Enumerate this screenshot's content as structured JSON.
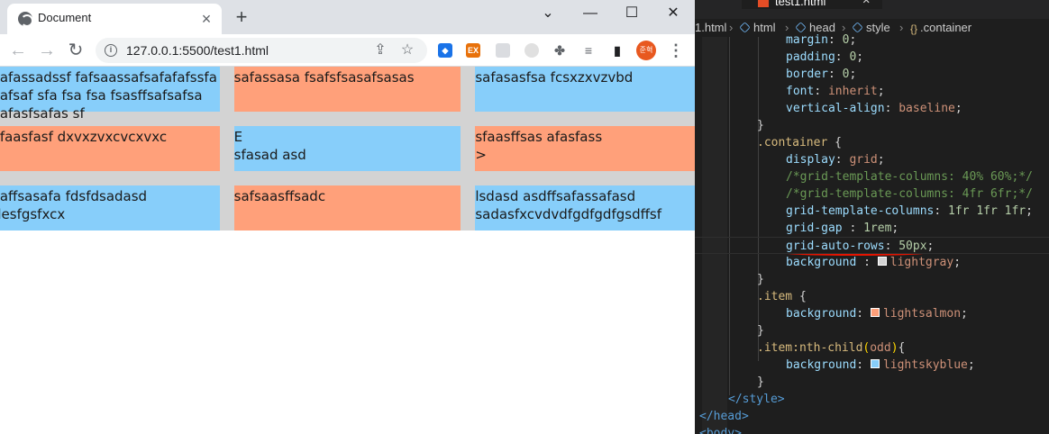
{
  "browser": {
    "tab_title": "Document",
    "url": "127.0.0.1:5500/test1.html",
    "profile_initials": "준혁",
    "ext_labels": [
      "",
      "EX",
      "",
      "",
      "",
      "",
      ""
    ]
  },
  "page": {
    "items": [
      "safassadssf fafsaassafsafafafssfa safsaf sfa fsa fsa fsasffsafsafsa safasfsafas sf",
      "safassasa fsafsfsasafsasas",
      "safasasfsa fcsxzxvzvbd",
      "sfaasfasf dxvxzvxcvcxvxc",
      "E\nsfasad asd",
      "sfaasffsas afasfass\n>",
      "saffsasafa fdsfdsadasd desfgsfxcx",
      "safsaasffsadc",
      "lsdasd asdffsafassafasd sadasfxcvdvdfgdfgdfgsdffsf"
    ]
  },
  "editor": {
    "tab_title": "test1.html",
    "breadcrumbs": [
      "1.html",
      "html",
      "head",
      "style",
      ".container"
    ],
    "lines": [
      {
        "indent": 3,
        "parts": [
          [
            "prop",
            "margin"
          ],
          [
            "punc",
            ": "
          ],
          [
            "num",
            "0"
          ],
          [
            "punc",
            ";"
          ]
        ]
      },
      {
        "indent": 3,
        "parts": [
          [
            "prop",
            "padding"
          ],
          [
            "punc",
            ": "
          ],
          [
            "num",
            "0"
          ],
          [
            "punc",
            ";"
          ]
        ]
      },
      {
        "indent": 3,
        "parts": [
          [
            "prop",
            "border"
          ],
          [
            "punc",
            ": "
          ],
          [
            "num",
            "0"
          ],
          [
            "punc",
            ";"
          ]
        ]
      },
      {
        "indent": 3,
        "parts": [
          [
            "prop",
            "font"
          ],
          [
            "punc",
            ": "
          ],
          [
            "val",
            "inherit"
          ],
          [
            "punc",
            ";"
          ]
        ]
      },
      {
        "indent": 3,
        "parts": [
          [
            "prop",
            "vertical-align"
          ],
          [
            "punc",
            ": "
          ],
          [
            "val",
            "baseline"
          ],
          [
            "punc",
            ";"
          ]
        ]
      },
      {
        "indent": 2,
        "parts": [
          [
            "punc",
            "}"
          ]
        ]
      },
      {
        "indent": 2,
        "parts": [
          [
            "sel",
            ".container"
          ],
          [
            "punc",
            " {"
          ]
        ]
      },
      {
        "indent": 3,
        "parts": [
          [
            "prop",
            "display"
          ],
          [
            "punc",
            ": "
          ],
          [
            "val",
            "grid"
          ],
          [
            "punc",
            ";"
          ]
        ]
      },
      {
        "indent": 3,
        "parts": [
          [
            "cmt",
            "/*grid-template-columns: 40% 60%;*/"
          ]
        ]
      },
      {
        "indent": 3,
        "parts": [
          [
            "cmt",
            "/*grid-template-columns: 4fr 6fr;*/"
          ]
        ]
      },
      {
        "indent": 3,
        "parts": [
          [
            "prop",
            "grid-template-columns"
          ],
          [
            "punc",
            ": "
          ],
          [
            "num",
            "1fr 1fr 1fr"
          ],
          [
            "punc",
            ";"
          ]
        ]
      },
      {
        "indent": 3,
        "parts": [
          [
            "prop",
            "grid-gap"
          ],
          [
            "punc",
            " : "
          ],
          [
            "num",
            "1rem"
          ],
          [
            "punc",
            ";"
          ]
        ]
      },
      {
        "indent": 3,
        "parts": [
          [
            "prop",
            "grid-auto-rows"
          ],
          [
            "punc",
            ": "
          ],
          [
            "num",
            "50px"
          ],
          [
            "punc",
            ";"
          ]
        ]
      },
      {
        "indent": 3,
        "parts": [
          [
            "prop",
            "background"
          ],
          [
            "punc",
            " : "
          ],
          [
            "swatch",
            "#d3d3d3"
          ],
          [
            "val",
            "lightgray"
          ],
          [
            "punc",
            ";"
          ]
        ]
      },
      {
        "indent": 2,
        "parts": [
          [
            "punc",
            "}"
          ]
        ]
      },
      {
        "indent": 2,
        "parts": [
          [
            "sel",
            ".item"
          ],
          [
            "punc",
            " {"
          ]
        ]
      },
      {
        "indent": 3,
        "parts": [
          [
            "prop",
            "background"
          ],
          [
            "punc",
            ": "
          ],
          [
            "swatch",
            "#ffa07a"
          ],
          [
            "val",
            "lightsalmon"
          ],
          [
            "punc",
            ";"
          ]
        ]
      },
      {
        "indent": 2,
        "parts": [
          [
            "punc",
            "}"
          ]
        ]
      },
      {
        "indent": 2,
        "parts": [
          [
            "sel",
            ".item:nth-child"
          ],
          [
            "brk",
            "("
          ],
          [
            "val",
            "odd"
          ],
          [
            "brk",
            ")"
          ],
          [
            "punc",
            "{"
          ]
        ]
      },
      {
        "indent": 3,
        "parts": [
          [
            "prop",
            "background"
          ],
          [
            "punc",
            ": "
          ],
          [
            "swatch",
            "#87cefa"
          ],
          [
            "val",
            "lightskyblue"
          ],
          [
            "punc",
            ";"
          ]
        ]
      },
      {
        "indent": 2,
        "parts": [
          [
            "punc",
            "}"
          ]
        ]
      },
      {
        "indent": 1,
        "parts": [
          [
            "tag",
            "</"
          ],
          [
            "tag",
            "style"
          ],
          [
            "tag",
            ">"
          ]
        ]
      },
      {
        "indent": 0,
        "parts": [
          [
            "tag",
            "</"
          ],
          [
            "tag",
            "head"
          ],
          [
            "tag",
            ">"
          ]
        ]
      },
      {
        "indent": 0,
        "parts": [
          [
            "tag",
            "<"
          ],
          [
            "tag",
            "body"
          ],
          [
            "tag",
            ">"
          ]
        ]
      }
    ]
  },
  "colors": {
    "item_odd": "#87cefa",
    "item_even": "#ffa07a",
    "grid_bg": "#d3d3d3"
  }
}
